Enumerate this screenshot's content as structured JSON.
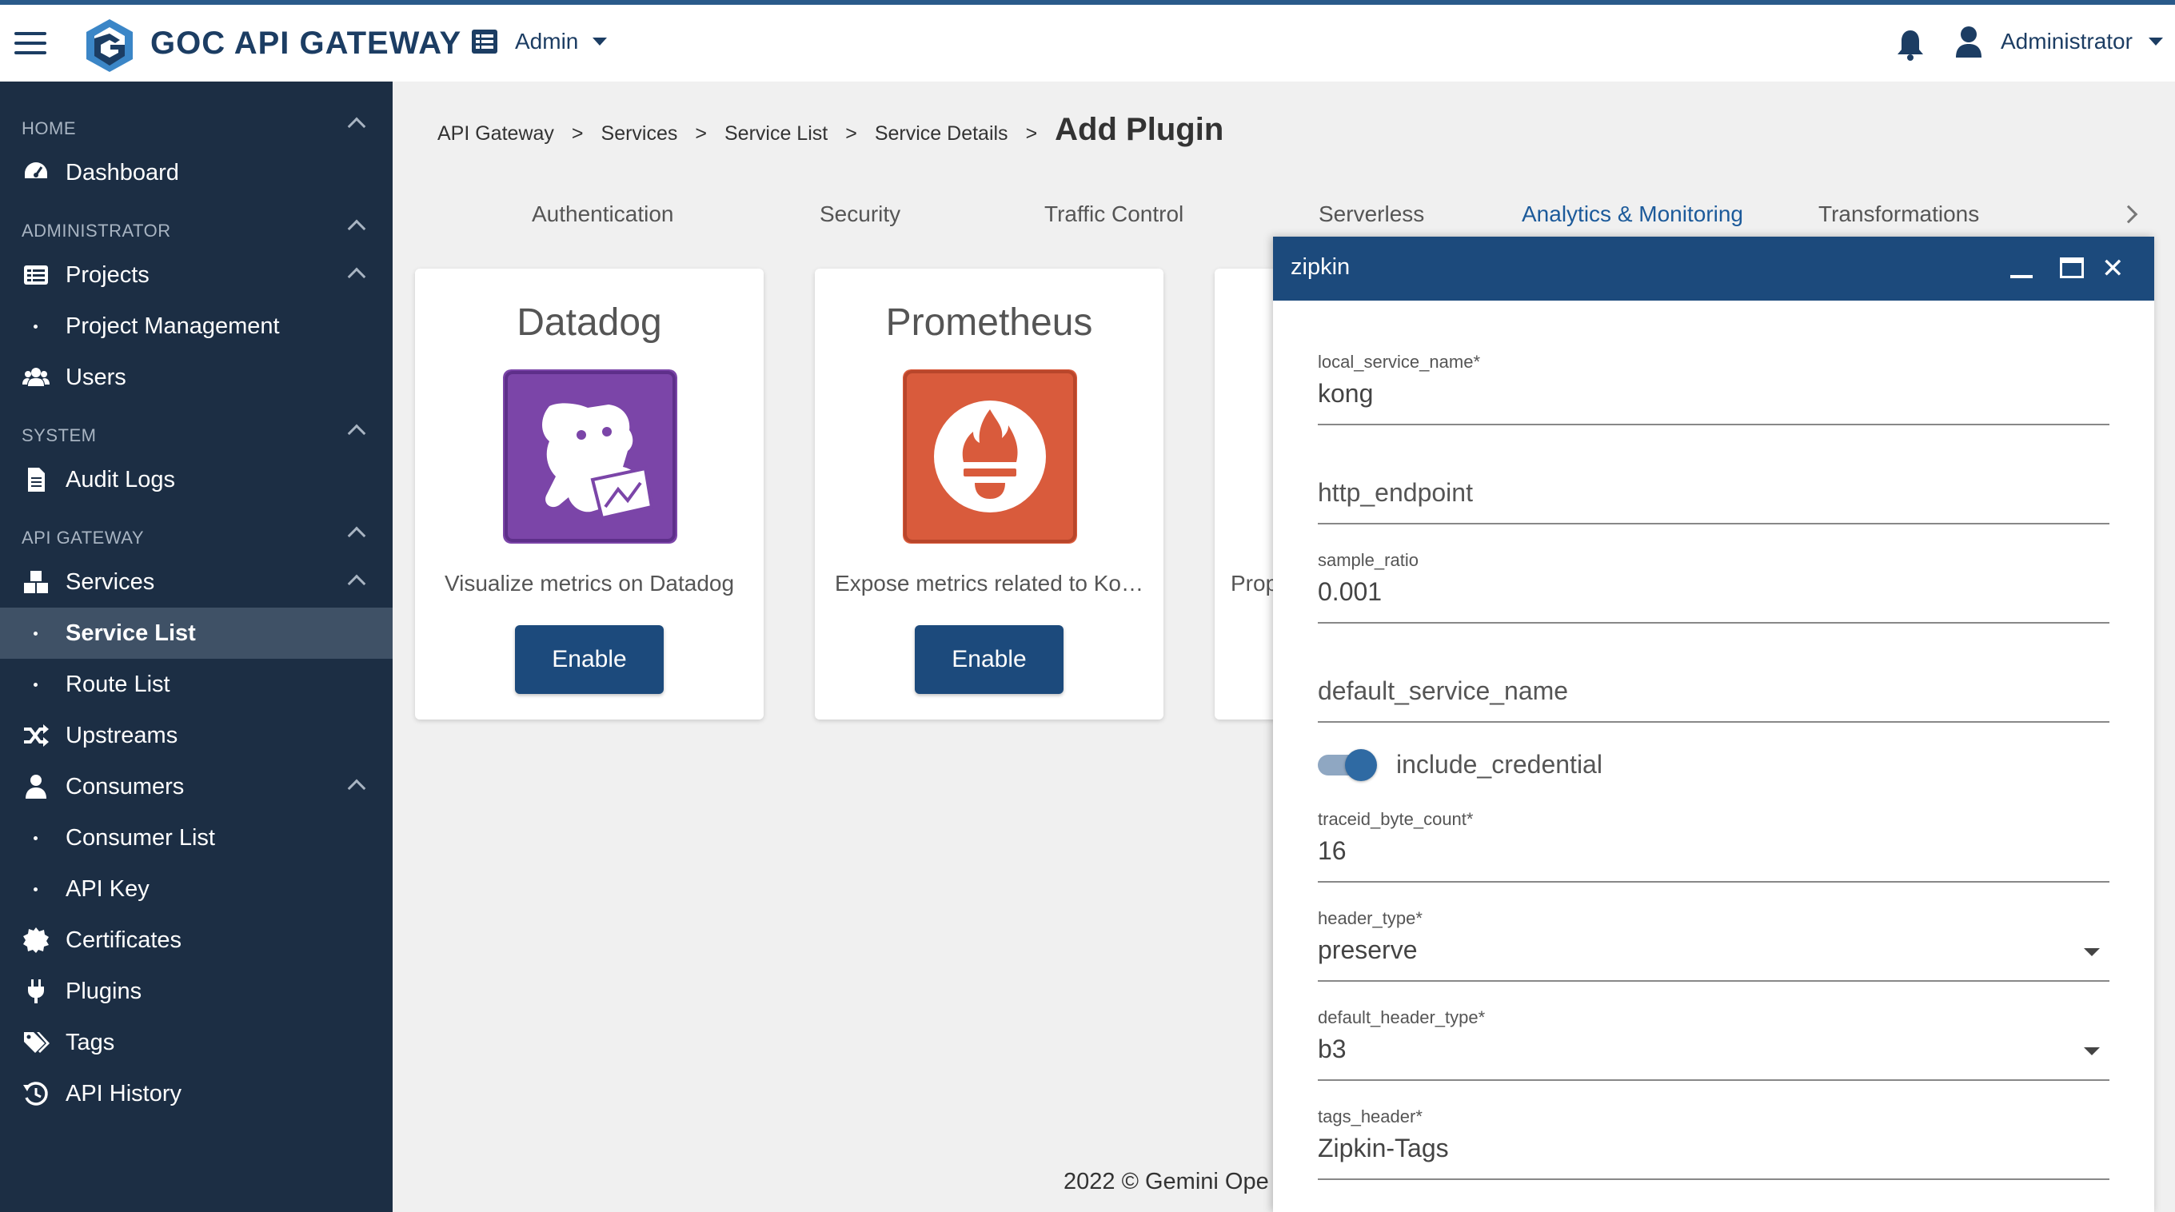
{
  "header": {
    "brand": "GOC API GATEWAY",
    "admin_menu": "Admin",
    "user_menu": "Administrator"
  },
  "sidebar": {
    "sections": {
      "home": "HOME",
      "administrator": "ADMINISTRATOR",
      "system": "SYSTEM",
      "api_gateway": "API GATEWAY"
    },
    "items": {
      "dashboard": "Dashboard",
      "projects": "Projects",
      "project_management": "Project Management",
      "users": "Users",
      "audit_logs": "Audit Logs",
      "services": "Services",
      "service_list": "Service List",
      "route_list": "Route List",
      "upstreams": "Upstreams",
      "consumers": "Consumers",
      "consumer_list": "Consumer List",
      "api_key": "API Key",
      "certificates": "Certificates",
      "plugins": "Plugins",
      "tags": "Tags",
      "api_history": "API History"
    }
  },
  "breadcrumb": {
    "items": [
      "API Gateway",
      "Services",
      "Service List",
      "Service Details"
    ],
    "separator": ">",
    "current": "Add Plugin"
  },
  "tabs": [
    "Authentication",
    "Security",
    "Traffic Control",
    "Serverless",
    "Analytics & Monitoring",
    "Transformations"
  ],
  "active_tab": "Analytics & Monitoring",
  "cards": [
    {
      "title": "Datadog",
      "description": "Visualize metrics on Datadog",
      "button": "Enable",
      "logo_color": "#7b45a8"
    },
    {
      "title": "Prometheus",
      "description": "Expose metrics related to Ko…",
      "button": "Enable",
      "logo_color": "#d95b3c"
    },
    {
      "description_partial": "Prop"
    }
  ],
  "footer": "2022 © Gemini Ope",
  "dialog": {
    "title": "zipkin",
    "fields": {
      "local_service_name": {
        "label": "local_service_name",
        "required": "*",
        "value": "kong"
      },
      "http_endpoint": {
        "placeholder": "http_endpoint"
      },
      "sample_ratio": {
        "label": "sample_ratio",
        "value": "0.001"
      },
      "default_service_name": {
        "placeholder": "default_service_name"
      },
      "include_credential": {
        "label": "include_credential",
        "checked": true
      },
      "traceid_byte_count": {
        "label": "traceid_byte_count",
        "required": "*",
        "value": "16"
      },
      "header_type": {
        "label": "header_type",
        "required": "*",
        "value": "preserve"
      },
      "default_header_type": {
        "label": "default_header_type",
        "required": "*",
        "value": "b3"
      },
      "tags_header": {
        "label": "tags_header",
        "required": "*",
        "value": "Zipkin-Tags"
      }
    }
  },
  "colors": {
    "primary": "#1c4a7c",
    "sidebar_bg": "#1c2e44",
    "sidebar_active": "#3f5166",
    "accent_tab": "#1c5a9a"
  },
  "icons": {
    "hamburger": "menu-icon",
    "logo": "goc-logo",
    "admin": "list-icon",
    "bell": "bell-icon",
    "user": "user-icon"
  }
}
